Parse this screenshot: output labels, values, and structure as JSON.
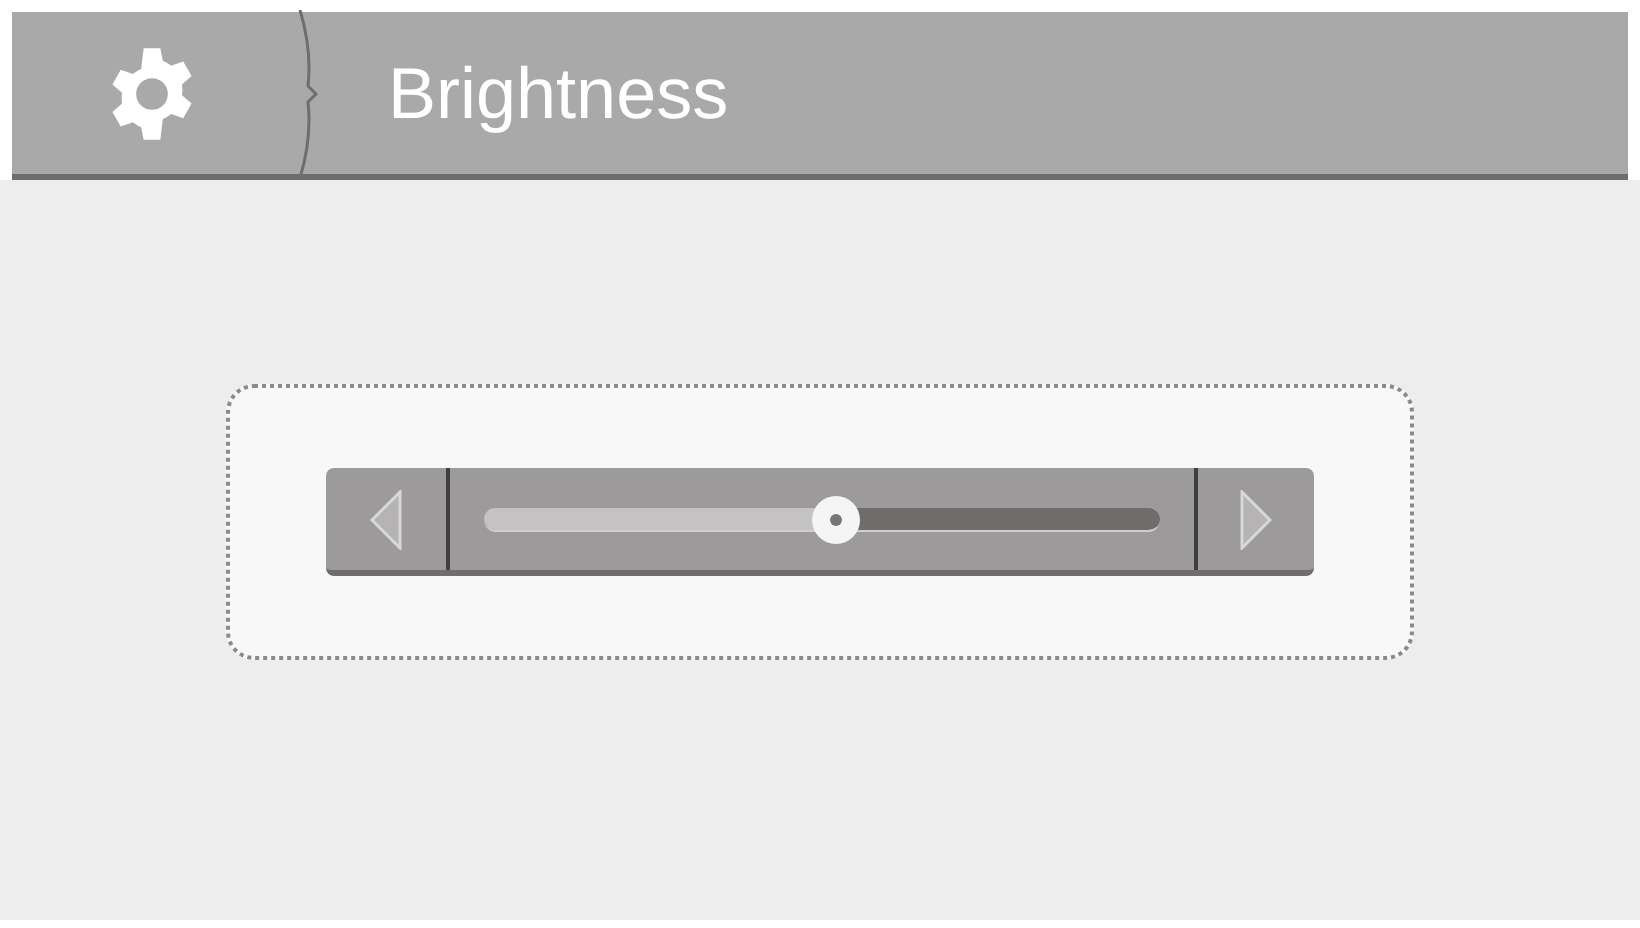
{
  "header": {
    "title": "Brightness"
  },
  "slider": {
    "level": 0.52
  }
}
